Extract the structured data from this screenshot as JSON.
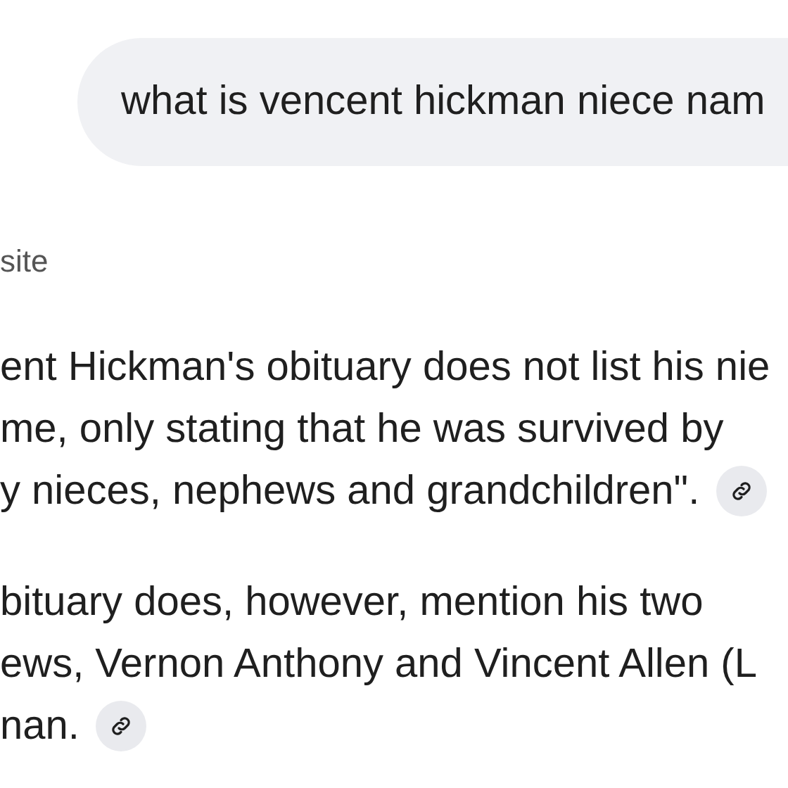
{
  "query": "what is vencent hickman niece nam",
  "source_label": "site",
  "paragraphs": [
    {
      "lines": [
        "ent Hickman's obituary does not list his nie",
        "me, only stating that he was survived by",
        "y nieces, nephews and grandchildren\"."
      ],
      "citation": true
    },
    {
      "lines": [
        "bituary does, however, mention his two",
        "ews, Vernon Anthony and Vincent Allen (L",
        "nan."
      ],
      "citation": true
    }
  ]
}
